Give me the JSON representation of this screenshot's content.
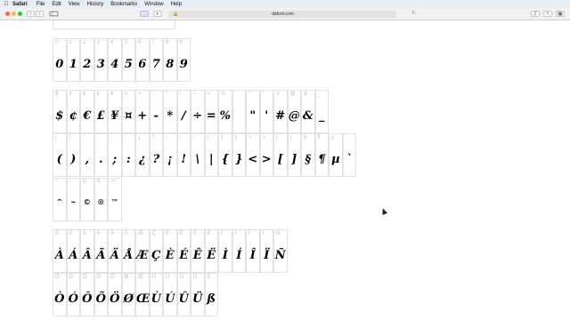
{
  "menubar": {
    "apple": "",
    "app": "Safari",
    "items": [
      "File",
      "Edit",
      "View",
      "History",
      "Bookmarks",
      "Window",
      "Help"
    ]
  },
  "toolbar": {
    "url": "dafont.com",
    "back": "‹",
    "forward": "›"
  },
  "rows": [
    {
      "cells": [
        {
          "hdr": "0",
          "glyph": "0"
        },
        {
          "hdr": "1",
          "glyph": "1"
        },
        {
          "hdr": "2",
          "glyph": "2"
        },
        {
          "hdr": "3",
          "glyph": "3"
        },
        {
          "hdr": "4",
          "glyph": "4"
        },
        {
          "hdr": "5",
          "glyph": "5"
        },
        {
          "hdr": "6",
          "glyph": "6"
        },
        {
          "hdr": "7",
          "glyph": "7"
        },
        {
          "hdr": "8",
          "glyph": "8"
        },
        {
          "hdr": "9",
          "glyph": "9"
        }
      ]
    },
    {
      "cells": [
        {
          "hdr": "$",
          "glyph": "$"
        },
        {
          "hdr": "¢",
          "glyph": "¢"
        },
        {
          "hdr": "€",
          "glyph": "€"
        },
        {
          "hdr": "£",
          "glyph": "£"
        },
        {
          "hdr": "¥",
          "glyph": "¥"
        },
        {
          "hdr": "¤",
          "glyph": "¤"
        },
        {
          "hdr": "+",
          "glyph": "+"
        },
        {
          "hdr": "-",
          "glyph": "-"
        },
        {
          "hdr": "*",
          "glyph": "*"
        },
        {
          "hdr": "/",
          "glyph": "/"
        },
        {
          "hdr": "÷",
          "glyph": "÷"
        },
        {
          "hdr": "=",
          "glyph": "="
        },
        {
          "hdr": "%",
          "glyph": "%"
        },
        {
          "hdr": "",
          "glyph": ""
        },
        {
          "hdr": "\"",
          "glyph": "\""
        },
        {
          "hdr": "'",
          "glyph": "'"
        },
        {
          "hdr": "#",
          "glyph": "#"
        },
        {
          "hdr": "@",
          "glyph": "@"
        },
        {
          "hdr": "&",
          "glyph": "&"
        },
        {
          "hdr": "_",
          "glyph": "_"
        }
      ]
    },
    {
      "cells": [
        {
          "hdr": "(",
          "glyph": "("
        },
        {
          "hdr": ")",
          "glyph": ")"
        },
        {
          "hdr": ",",
          "glyph": ","
        },
        {
          "hdr": ".",
          "glyph": "."
        },
        {
          "hdr": ";",
          "glyph": ";"
        },
        {
          "hdr": ":",
          "glyph": ":"
        },
        {
          "hdr": "¿",
          "glyph": "¿"
        },
        {
          "hdr": "?",
          "glyph": "?"
        },
        {
          "hdr": "¡",
          "glyph": "¡"
        },
        {
          "hdr": "!",
          "glyph": "!"
        },
        {
          "hdr": "\\",
          "glyph": "\\"
        },
        {
          "hdr": "|",
          "glyph": "|"
        },
        {
          "hdr": "{",
          "glyph": "{"
        },
        {
          "hdr": "}",
          "glyph": "}"
        },
        {
          "hdr": "<",
          "glyph": "<"
        },
        {
          "hdr": ">",
          "glyph": ">"
        },
        {
          "hdr": "[",
          "glyph": "["
        },
        {
          "hdr": "]",
          "glyph": "]"
        },
        {
          "hdr": "§",
          "glyph": "§"
        },
        {
          "hdr": "¶",
          "glyph": "¶"
        },
        {
          "hdr": "µ",
          "glyph": "µ"
        },
        {
          "hdr": "`",
          "glyph": "`"
        }
      ]
    },
    {
      "cells": [
        {
          "hdr": "^",
          "glyph": "^"
        },
        {
          "hdr": "~",
          "glyph": "~"
        },
        {
          "hdr": "©",
          "glyph": "©"
        },
        {
          "hdr": "®",
          "glyph": "®"
        },
        {
          "hdr": "™",
          "glyph": "™"
        }
      ]
    },
    {
      "cells": [
        {
          "hdr": "À",
          "glyph": "À"
        },
        {
          "hdr": "Á",
          "glyph": "Á"
        },
        {
          "hdr": "Â",
          "glyph": "Â"
        },
        {
          "hdr": "Ã",
          "glyph": "Ã"
        },
        {
          "hdr": "Ä",
          "glyph": "Ä"
        },
        {
          "hdr": "Å",
          "glyph": "Å"
        },
        {
          "hdr": "Æ",
          "glyph": "Æ"
        },
        {
          "hdr": "Ç",
          "glyph": "Ç"
        },
        {
          "hdr": "È",
          "glyph": "È"
        },
        {
          "hdr": "É",
          "glyph": "É"
        },
        {
          "hdr": "Ê",
          "glyph": "Ê"
        },
        {
          "hdr": "Ë",
          "glyph": "Ë"
        },
        {
          "hdr": "Ì",
          "glyph": "Ì"
        },
        {
          "hdr": "Í",
          "glyph": "Í"
        },
        {
          "hdr": "Î",
          "glyph": "Î"
        },
        {
          "hdr": "Ï",
          "glyph": "Ï"
        },
        {
          "hdr": "Ñ",
          "glyph": "Ñ"
        }
      ]
    },
    {
      "cells": [
        {
          "hdr": "Ò",
          "glyph": "Ò"
        },
        {
          "hdr": "Ó",
          "glyph": "Ó"
        },
        {
          "hdr": "Ô",
          "glyph": "Ô"
        },
        {
          "hdr": "Õ",
          "glyph": "Õ"
        },
        {
          "hdr": "Ö",
          "glyph": "Ö"
        },
        {
          "hdr": "Ø",
          "glyph": "Ø"
        },
        {
          "hdr": "Œ",
          "glyph": "Œ"
        },
        {
          "hdr": "Ù",
          "glyph": "Ù"
        },
        {
          "hdr": "Ú",
          "glyph": "Ú"
        },
        {
          "hdr": "Û",
          "glyph": "Û"
        },
        {
          "hdr": "Ü",
          "glyph": "Ü"
        },
        {
          "hdr": "ß",
          "glyph": "ß"
        }
      ]
    }
  ],
  "colors": {
    "menubar": "#e8ecf5",
    "toolbar": "#f1f1f1",
    "light_red": "#ff5f57",
    "light_yellow": "#febc2e",
    "light_green": "#28c840"
  }
}
